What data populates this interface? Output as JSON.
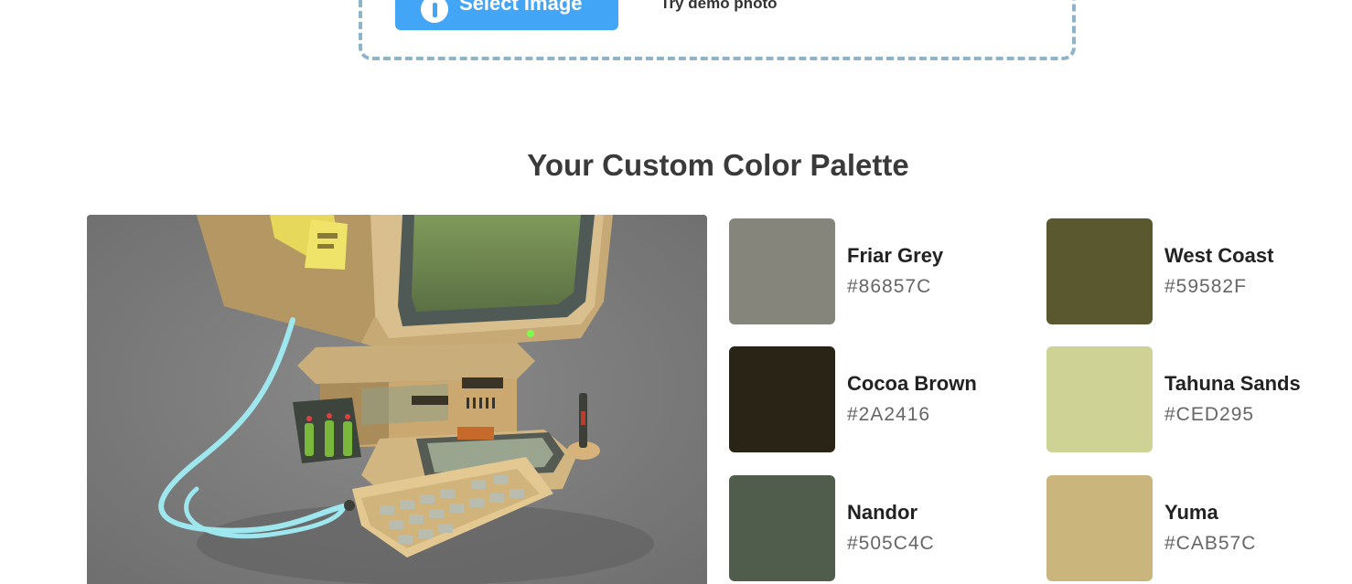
{
  "upload": {
    "select_label": "Select Image",
    "demo_label": "Try demo photo"
  },
  "heading": "Your Custom Color Palette",
  "palette": [
    {
      "name": "Friar Grey",
      "hex": "#86857C",
      "color": "#86857C"
    },
    {
      "name": "West Coast",
      "hex": "#59582F",
      "color": "#59582F"
    },
    {
      "name": "Cocoa Brown",
      "hex": "#2A2416",
      "color": "#2A2416"
    },
    {
      "name": "Tahuna Sands",
      "hex": "#CED295",
      "color": "#CED295"
    },
    {
      "name": "Nandor",
      "hex": "#505C4C",
      "color": "#505C4C"
    },
    {
      "name": "Yuma",
      "hex": "#CAB57C",
      "color": "#CAB57C"
    }
  ]
}
